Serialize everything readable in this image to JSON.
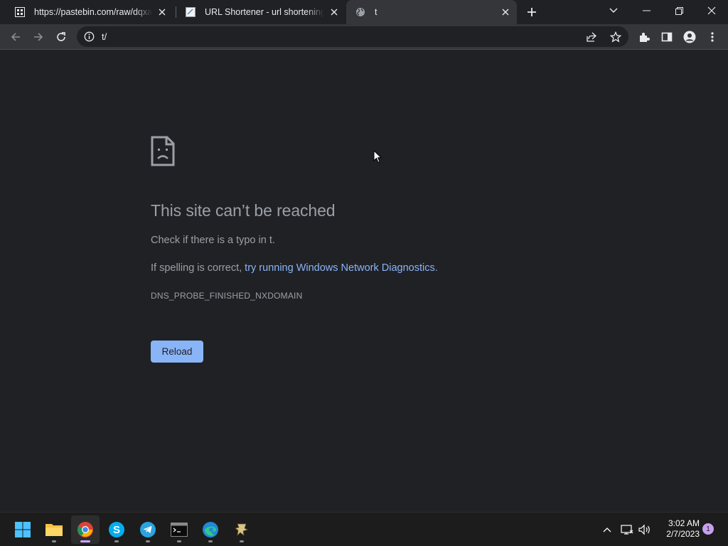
{
  "browser": {
    "tabs": [
      {
        "title": "https://pastebin.com/raw/dqxaxV",
        "favicon": "pastebin-favicon-icon"
      },
      {
        "title": "URL Shortener - url shortening se",
        "favicon": "document-favicon-icon"
      },
      {
        "title": "t",
        "favicon": "globe-icon",
        "active": true
      }
    ],
    "address_bar": {
      "value": "t/"
    }
  },
  "page": {
    "heading": "This site can’t be reached",
    "line1": "Check if there is a typo in t.",
    "line2_prefix": "If spelling is correct, ",
    "line2_link": "try running Windows Network Diagnostics",
    "line2_suffix": ".",
    "error_code": "DNS_PROBE_FINISHED_NXDOMAIN",
    "reload_label": "Reload"
  },
  "taskbar": {
    "apps": [
      "windows-start",
      "file-explorer",
      "chrome",
      "skype",
      "telegram",
      "terminal",
      "edge",
      "other-app"
    ],
    "clock": {
      "time": "3:02 AM",
      "date": "2/7/2023"
    },
    "notification_count": "1"
  },
  "colors": {
    "accent": "#8ab4f8",
    "background": "#202124",
    "toolbar": "#35363a"
  }
}
